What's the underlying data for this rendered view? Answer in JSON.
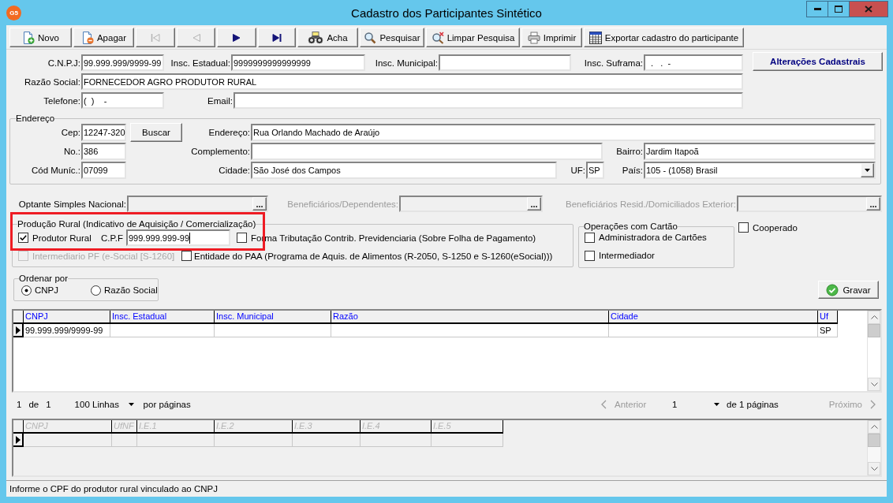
{
  "window": {
    "logo": "G5",
    "title": "Cadastro dos Participantes Sintético"
  },
  "toolbar": [
    {
      "kind": "new",
      "label": "Novo",
      "disabled": false
    },
    {
      "kind": "delete",
      "label": "Apagar",
      "disabled": false
    },
    {
      "kind": "first",
      "disabled": true
    },
    {
      "kind": "previous",
      "disabled": true
    },
    {
      "kind": "next",
      "disabled": false
    },
    {
      "kind": "last",
      "disabled": false
    },
    {
      "kind": "find",
      "label": "Acha",
      "disabled": false
    },
    {
      "kind": "search",
      "label": "Pesquisar",
      "disabled": false
    },
    {
      "kind": "clear_search",
      "label": "Limpar Pesquisa",
      "disabled": false
    },
    {
      "kind": "print",
      "label": "Imprimir",
      "disabled": false
    },
    {
      "kind": "export",
      "label": "Exportar cadastro do participante",
      "disabled": false
    }
  ],
  "identification": {
    "cnpj": {
      "label": "C.N.P.J:",
      "value": "99.999.999/9999-99"
    },
    "insc_estadual": {
      "label": "Insc. Estadual:",
      "value": "9999999999999999"
    },
    "insc_municipal": {
      "label": "Insc. Municipal:"
    },
    "insc_suframa": {
      "label": "Insc. Suframa:",
      "value": "  .   .  -"
    },
    "razao_social": {
      "label": "Razão Social:",
      "value": "FORNECEDOR AGRO PRODUTOR RURAL"
    },
    "telefone": {
      "label": "Telefone:",
      "value": "(  )    -"
    },
    "email": {
      "label": "Email:"
    }
  },
  "changes_button": "Alterações Cadastrais",
  "address": {
    "legend": "Endereço",
    "cep": {
      "label": "Cep:",
      "value": "12247-320"
    },
    "search_button": "Buscar",
    "endereco": {
      "label": "Endereço:",
      "value": "Rua Orlando Machado de Araújo"
    },
    "numero": {
      "label": "No.:",
      "value": "386"
    },
    "complemento": {
      "label": "Complemento:"
    },
    "bairro": {
      "label": "Bairro:",
      "value": "Jardim Itapoã"
    },
    "cod_municipio": {
      "label": "Cód Muníc.:",
      "value": "07099"
    },
    "cidade": {
      "label": "Cidade:",
      "value": "São José dos Campos"
    },
    "uf": {
      "label": "UF:",
      "value": "SP"
    },
    "pais": {
      "label": "País:",
      "value": "105 - (1058) Brasil"
    }
  },
  "lookups": [
    {
      "label": "Optante Simples Nacional:",
      "disabled": false,
      "button": "..."
    },
    {
      "label": "Beneficiários/Dependentes:",
      "disabled": true,
      "button": "..."
    },
    {
      "label": "Beneficiários Resid./Domiciliados Exterior:",
      "disabled": true,
      "button": "..."
    }
  ],
  "rural_production": {
    "legend": "Produção Rural (Indicativo de Aquisição / Comercialização)",
    "highlighted": true,
    "produtor_rural": {
      "label": "Produtor Rural",
      "checked": true,
      "disabled": false
    },
    "cpf": {
      "label": "C.P.F",
      "value": "999.999.999-99",
      "focused": true
    },
    "forma_tributacao": {
      "label": "Forma Tributação Contrib. Previdenciaria (Sobre Folha de Pagamento)",
      "checked": false,
      "disabled": false
    },
    "intermediario_pf": {
      "label": "Intermediario PF (e-Social [S-1260]",
      "checked": false,
      "disabled": true
    },
    "entidade_paa": {
      "label": "Entidade do PAA (Programa de Aquis. de Alimentos (R-2050, S-1250 e S-1260(eSocial)))",
      "checked": false,
      "disabled": false
    }
  },
  "card_operations": {
    "legend": "Operações com Cartão",
    "options": [
      {
        "label": "Administradora de Cartões",
        "checked": false,
        "disabled": false
      },
      {
        "label": "Intermediador",
        "checked": false,
        "disabled": false
      }
    ]
  },
  "cooperado": {
    "label": "Cooperado",
    "checked": false,
    "disabled": false
  },
  "sort_by": {
    "legend": "Ordenar por",
    "options": [
      {
        "label": "CNPJ",
        "selected": true
      },
      {
        "label": "Razão Social",
        "selected": false
      }
    ]
  },
  "save_button": "Gravar",
  "participants_table": {
    "disabled": false,
    "columns": [
      "CNPJ",
      "Insc. Estadual",
      "Insc. Municipal",
      "Razão",
      "Cidade",
      "Uf"
    ],
    "rows": [
      {
        "current": true,
        "cells": [
          "99.999.999/9999-99",
          null,
          null,
          null,
          null,
          "SP"
        ]
      }
    ]
  },
  "pagination": {
    "page": "1",
    "of": "de",
    "total": "1",
    "page_size": "100 Linhas",
    "per_page": "por páginas",
    "previous": {
      "label": "Anterior",
      "disabled": true
    },
    "current_page": "1",
    "pages": "de 1 páginas",
    "next": {
      "label": "Próximo",
      "disabled": true
    }
  },
  "inscriptions_table": {
    "disabled": true,
    "columns": [
      "CNPJ",
      "UfNF",
      "I.E.1",
      "I.E.2",
      "I.E.3",
      "I.E.4",
      "I.E.5"
    ],
    "rows": [
      {
        "current": true,
        "cells": [
          null,
          null,
          null,
          null,
          null,
          null,
          null
        ]
      }
    ]
  },
  "status_bar": "Informe o CPF do produtor rural vinculado ao CNPJ"
}
